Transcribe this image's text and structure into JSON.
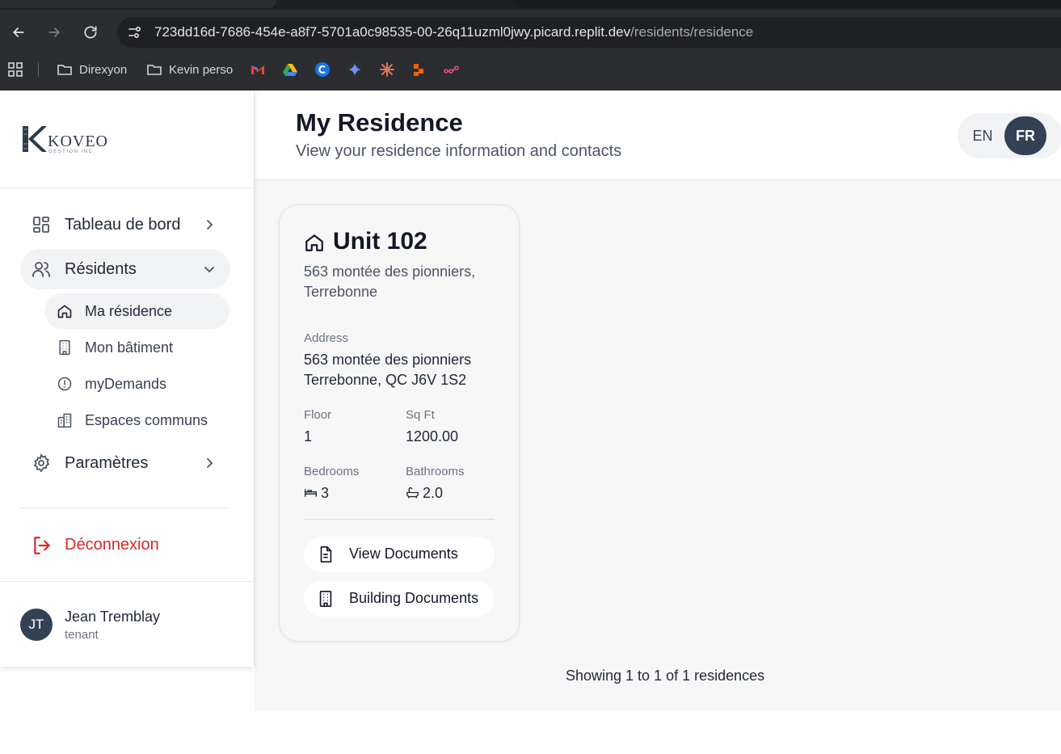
{
  "browser": {
    "url_host": "723dd16d-7686-454e-a8f7-5701a0c98535-00-26q11uzml0jwy.picard.replit.dev",
    "url_path": "/residents/residence",
    "bookmarks": [
      {
        "label": "Direxyon",
        "icon": "folder-icon"
      },
      {
        "label": "Kevin perso",
        "icon": "folder-icon"
      }
    ],
    "bookmark_icons": [
      "gmail-icon",
      "google-drive-icon",
      "c-app-icon",
      "gemini-icon",
      "claude-icon",
      "red-app-icon",
      "pink-app-icon"
    ]
  },
  "sidebar": {
    "logo_text": "KOVEO",
    "logo_sub": "GESTION INC.",
    "nav": {
      "dashboard": "Tableau de bord",
      "residents": "Résidents",
      "settings": "Paramètres"
    },
    "sub": {
      "my_residence": "Ma résidence",
      "my_building": "Mon bâtiment",
      "my_demands": "myDemands",
      "common_spaces": "Espaces communs"
    },
    "logout": "Déconnexion",
    "user": {
      "initials": "JT",
      "name": "Jean Tremblay",
      "role": "tenant"
    }
  },
  "header": {
    "title": "My Residence",
    "subtitle": "View your residence information and contacts",
    "lang_en": "EN",
    "lang_fr": "FR",
    "active_lang": "FR"
  },
  "residence": {
    "unit": "Unit 102",
    "address_short": "563 montée des pionniers, Terrebonne",
    "address_label": "Address",
    "address_line1": "563 montée des pionniers",
    "address_line2": "Terrebonne, QC J6V 1S2",
    "floor_label": "Floor",
    "floor": "1",
    "sqft_label": "Sq Ft",
    "sqft": "1200.00",
    "bedrooms_label": "Bedrooms",
    "bedrooms": "3",
    "bathrooms_label": "Bathrooms",
    "bathrooms": "2.0",
    "view_documents": "View Documents",
    "building_documents": "Building Documents"
  },
  "pagination": {
    "summary": "Showing 1 to 1 of 1 residences"
  },
  "colors": {
    "accent_dark": "#334155",
    "danger": "#dc2626"
  }
}
